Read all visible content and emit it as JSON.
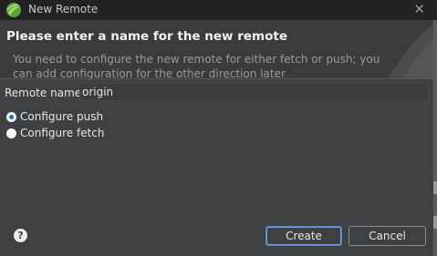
{
  "window": {
    "title": "New Remote"
  },
  "header": {
    "heading": "Please enter a name for the new remote",
    "description": "You need to configure the new remote for either fetch or push; you can add configuration for the other direction later"
  },
  "form": {
    "remote_name_label": "Remote name:",
    "remote_name_value": "origin",
    "options": [
      {
        "label": "Configure push",
        "selected": true
      },
      {
        "label": "Configure fetch",
        "selected": false
      }
    ]
  },
  "buttons": {
    "create": "Create",
    "cancel": "Cancel"
  },
  "colors": {
    "accent": "#1a6fd6",
    "dialog_bg": "#3f4042",
    "titlebar_bg": "#202224"
  }
}
